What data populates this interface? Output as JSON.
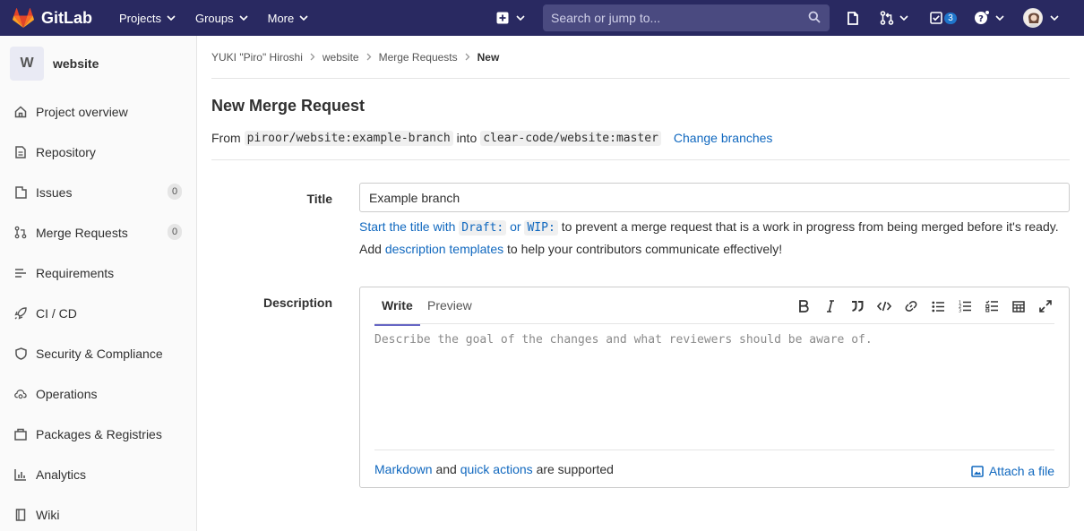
{
  "topbar": {
    "brand": "GitLab",
    "nav": [
      {
        "label": "Projects"
      },
      {
        "label": "Groups"
      },
      {
        "label": "More"
      }
    ],
    "search_placeholder": "Search or jump to...",
    "todo_count": "3"
  },
  "sidebar": {
    "project_initial": "W",
    "project_name": "website",
    "items": [
      {
        "label": "Project overview",
        "icon": "home-icon"
      },
      {
        "label": "Repository",
        "icon": "document-icon"
      },
      {
        "label": "Issues",
        "icon": "issues-icon",
        "count": "0"
      },
      {
        "label": "Merge Requests",
        "icon": "merge-request-icon",
        "count": "0"
      },
      {
        "label": "Requirements",
        "icon": "requirements-icon"
      },
      {
        "label": "CI / CD",
        "icon": "rocket-icon"
      },
      {
        "label": "Security & Compliance",
        "icon": "shield-icon"
      },
      {
        "label": "Operations",
        "icon": "cloud-gear-icon"
      },
      {
        "label": "Packages & Registries",
        "icon": "package-icon"
      },
      {
        "label": "Analytics",
        "icon": "chart-icon"
      },
      {
        "label": "Wiki",
        "icon": "book-icon"
      }
    ]
  },
  "breadcrumb": {
    "items": [
      "YUKI \"Piro\" Hiroshi",
      "website",
      "Merge Requests"
    ],
    "current": "New"
  },
  "page": {
    "title": "New Merge Request",
    "from_label": "From",
    "source_branch": "piroor/website:example-branch",
    "into_label": "into",
    "target_branch": "clear-code/website:master",
    "change_branches": "Change branches"
  },
  "form": {
    "title_label": "Title",
    "title_value": "Example branch",
    "hint1_link": "Start the title with",
    "hint1_code1": "Draft:",
    "hint1_or": "or",
    "hint1_code2": "WIP:",
    "hint1_rest": "to prevent a merge request that is a work in progress from being merged before it's ready.",
    "hint2_add": "Add",
    "hint2_link": "description templates",
    "hint2_rest": "to help your contributors communicate effectively!",
    "description_label": "Description",
    "tab_write": "Write",
    "tab_preview": "Preview",
    "description_placeholder": "Describe the goal of the changes and what reviewers should be aware of.",
    "markdown_link": "Markdown",
    "and_text": "and",
    "quick_actions_link": "quick actions",
    "supported_text": "are supported",
    "attach_file": "Attach a file"
  }
}
